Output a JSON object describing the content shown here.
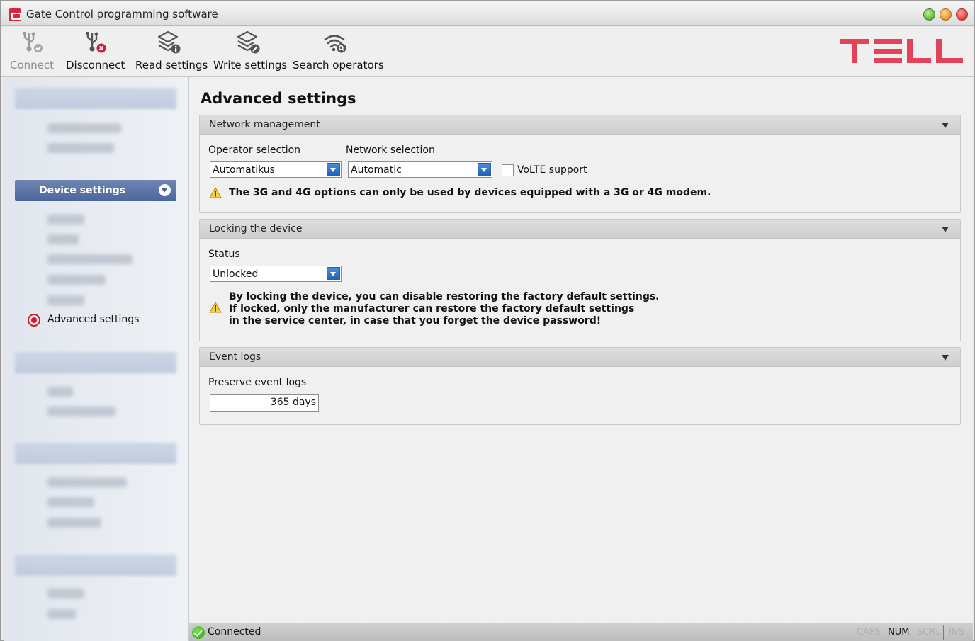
{
  "window": {
    "title": "Gate Control programming software"
  },
  "toolbar": {
    "connect": "Connect",
    "disconnect": "Disconnect",
    "read_settings": "Read settings",
    "write_settings": "Write settings",
    "search_operators": "Search operators"
  },
  "logo": {
    "text": "TELL",
    "color": "#e4415a"
  },
  "sidebar": {
    "device_settings": "Device settings",
    "advanced_settings": "Advanced settings"
  },
  "main": {
    "title": "Advanced settings",
    "network": {
      "header": "Network management",
      "operator_label": "Operator selection",
      "operator_value": "Automatikus",
      "network_label": "Network selection",
      "network_value": "Automatic",
      "volte_label": "VoLTE support",
      "volte_checked": false,
      "warning": "The 3G and 4G options can only be used by devices equipped with a 3G or 4G modem."
    },
    "locking": {
      "header": "Locking the device",
      "status_label": "Status",
      "status_value": "Unlocked",
      "warning_line1": "By locking the device, you can disable restoring the factory default settings.",
      "warning_line2": "If locked, only the manufacturer can restore the factory default settings",
      "warning_line3": "in the service center, in case that you forget the device password!"
    },
    "event_logs": {
      "header": "Event logs",
      "preserve_label": "Preserve event logs",
      "preserve_value": "365 days"
    }
  },
  "statusbar": {
    "status": "Connected",
    "caps": "CAPS",
    "num": "NUM",
    "scrl": "SCRL",
    "ins": "INS"
  }
}
